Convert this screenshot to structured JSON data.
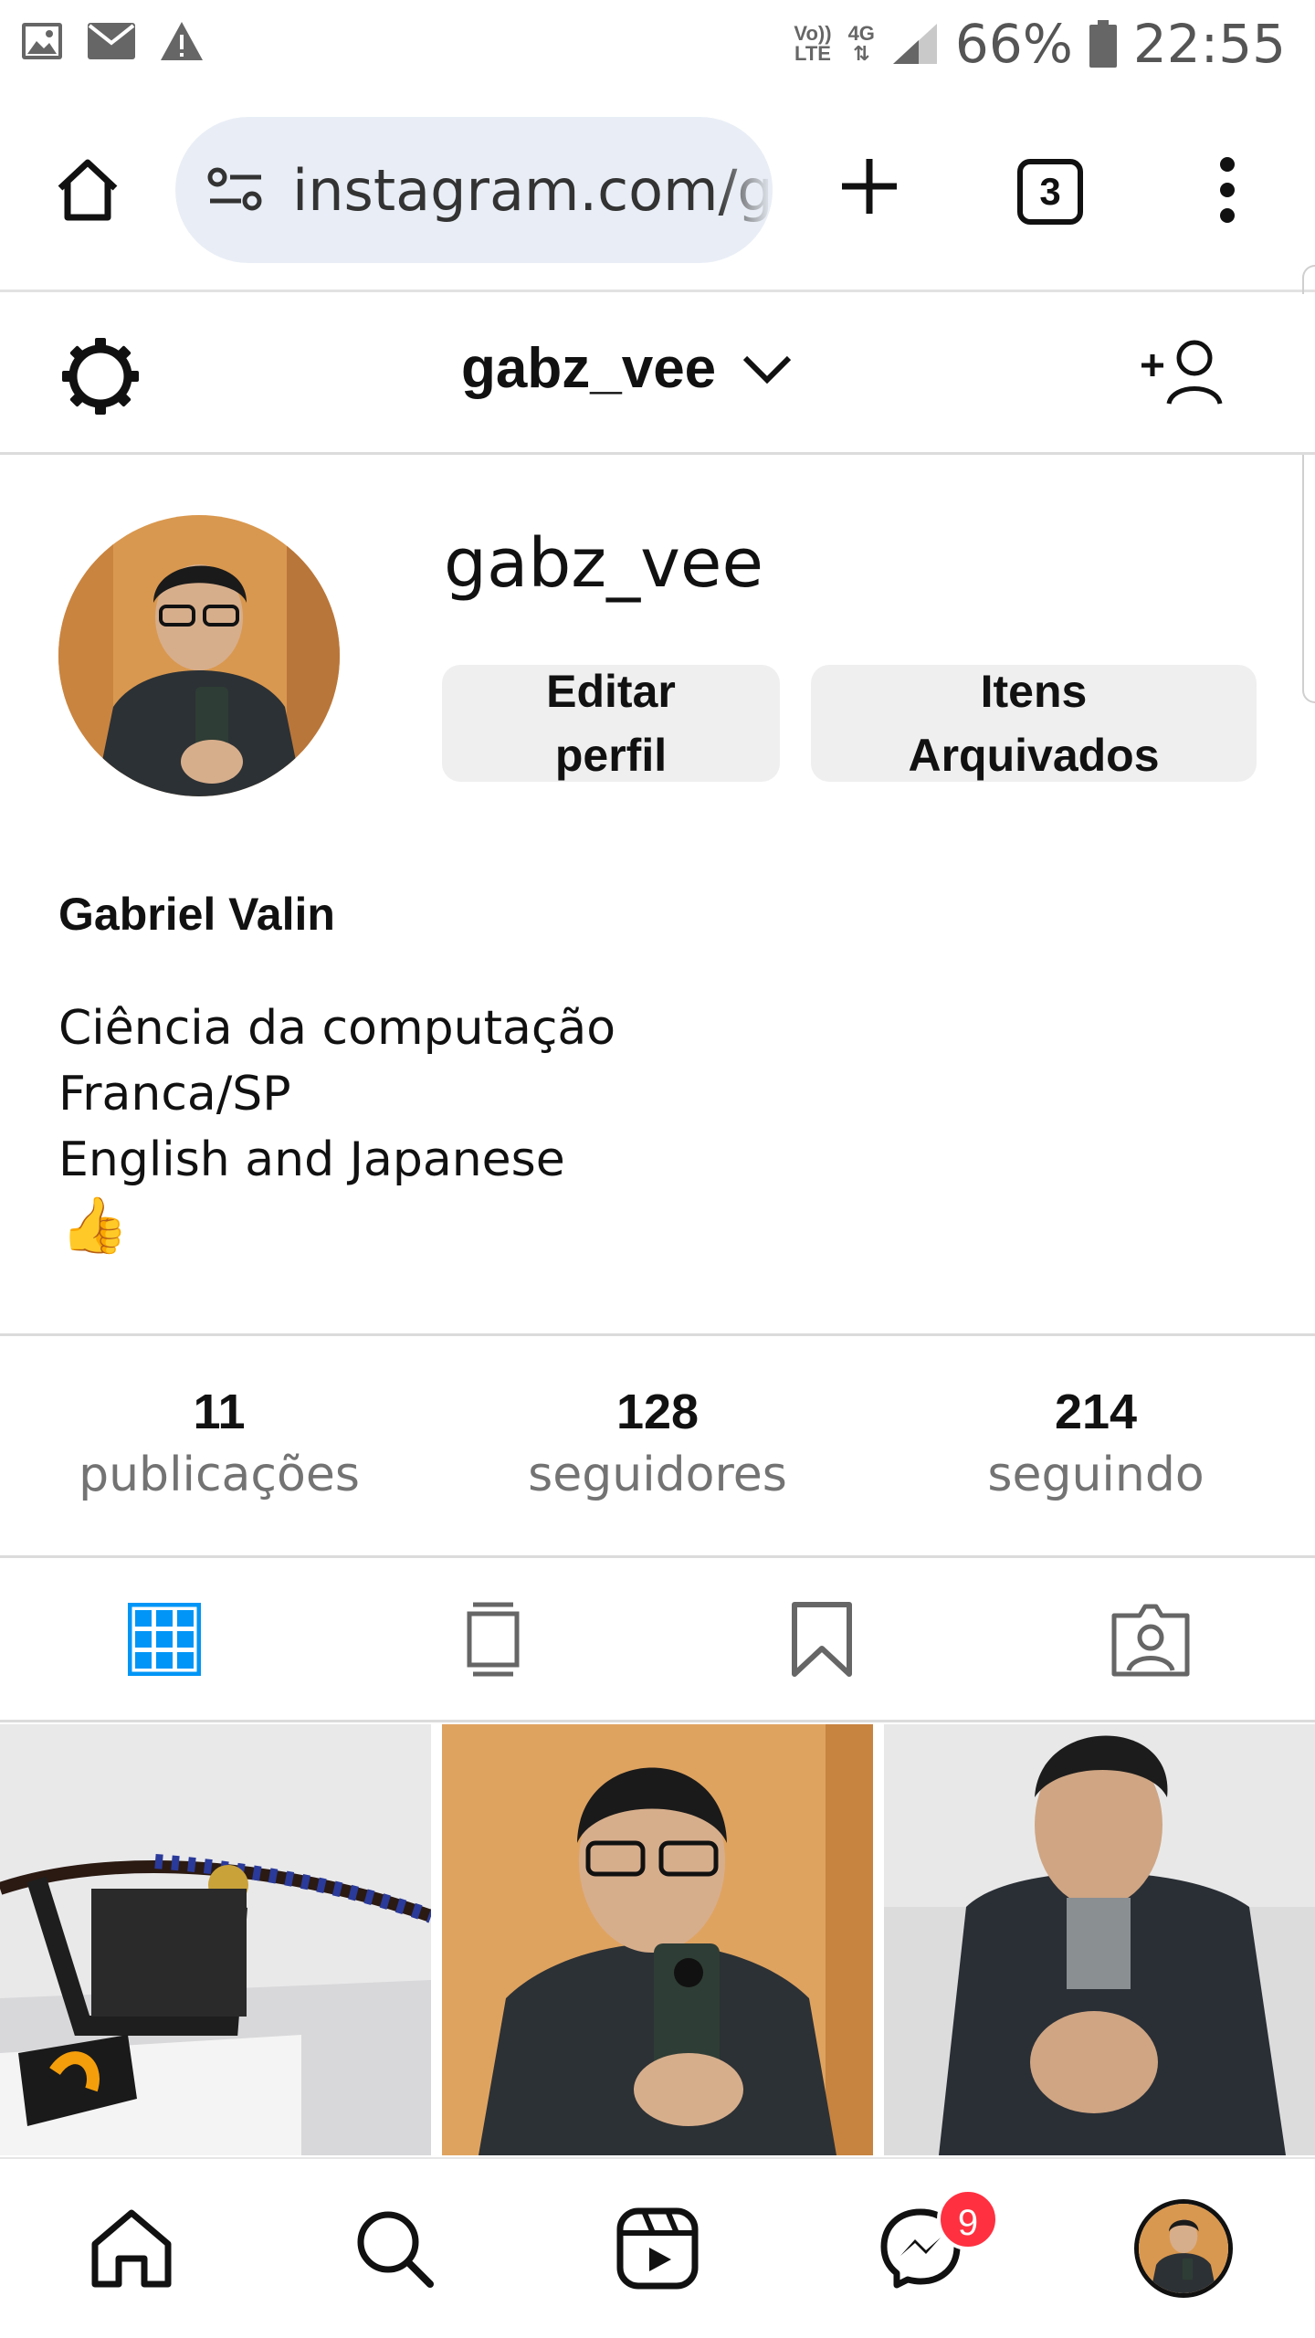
{
  "status_bar": {
    "network_label_top": "Vo))",
    "network_label_bottom": "LTE",
    "data_label": "4G",
    "battery_pct": "66%",
    "time": "22:55",
    "icons": [
      "image-icon",
      "mail-icon",
      "warning-icon",
      "signal-icon",
      "battery-icon"
    ]
  },
  "browser": {
    "url": "instagram.com/gabz_vee",
    "tab_count": "3",
    "icons": [
      "home-icon",
      "site-settings-icon",
      "new-tab-icon",
      "tabs-icon",
      "more-icon"
    ]
  },
  "header": {
    "username": "gabz_vee",
    "icons": [
      "settings-icon",
      "chevron-down-icon",
      "add-user-icon"
    ]
  },
  "profile": {
    "username": "gabz_vee",
    "edit_button": "Editar perfil",
    "archived_button": "Itens Arquivados",
    "full_name": "Gabriel Valin",
    "bio": [
      "Ciência da computação",
      "Franca/SP",
      "English and Japanese"
    ],
    "bio_emoji": "👍"
  },
  "stats": [
    {
      "value": "11",
      "label": "publicações"
    },
    {
      "value": "128",
      "label": "seguidores"
    },
    {
      "value": "214",
      "label": "seguindo"
    }
  ],
  "tabs": [
    "grid-icon",
    "feed-icon",
    "saved-icon",
    "tagged-icon"
  ],
  "bottom_nav": {
    "messages_badge": "9",
    "icons": [
      "home-icon",
      "search-icon",
      "reels-icon",
      "messenger-icon",
      "profile-avatar"
    ]
  },
  "colors": {
    "accent": "#0095f6",
    "badge": "#ff3040",
    "url_pill": "#e9eef6",
    "button_bg": "#efefef",
    "muted_text": "#737373"
  }
}
